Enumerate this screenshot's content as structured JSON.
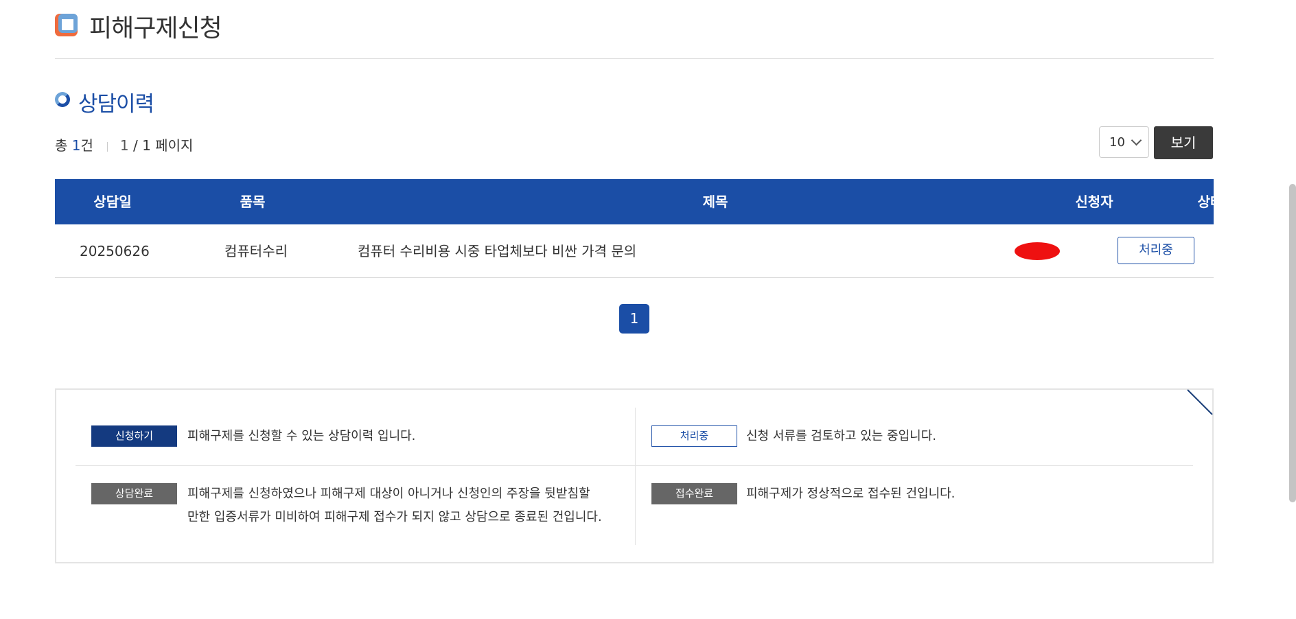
{
  "page": {
    "title": "피해구제신청"
  },
  "section": {
    "title": "상담이력"
  },
  "summary": {
    "total_prefix": "총 ",
    "total_count": "1",
    "total_suffix": "건",
    "current_page": "1",
    "page_rest": " / 1 페이지"
  },
  "controls": {
    "page_size_value": "10",
    "view_button_label": "보기"
  },
  "table": {
    "columns": [
      "상담일",
      "품목",
      "제목",
      "신청자",
      "상태"
    ],
    "rows": [
      {
        "date": "20250626",
        "item": "컴퓨터수리",
        "title": "컴퓨터 수리비용 시중 타업체보다 비싼 가격 문의",
        "applicant": "",
        "status": "처리중"
      }
    ]
  },
  "pagination": {
    "pages": [
      "1"
    ],
    "active": "1"
  },
  "legend": {
    "items": [
      {
        "tag": "신청하기",
        "text": "피해구제를 신청할 수 있는 상담이력 입니다."
      },
      {
        "tag": "처리중",
        "text": "신청 서류를 검토하고 있는 중입니다."
      },
      {
        "tag": "상담완료",
        "text_line1": "피해구제를 신청하였으나 피해구제 대상이 아니거나 신청인의 주장을 뒷받침할",
        "text_line2": "만한 입증서류가 미비하여 피해구제 접수가 되지 않고 상담으로 종료된 건입니다."
      },
      {
        "tag": "접수완료",
        "text": "피해구제가 정상적으로 접수된 건입니다."
      }
    ]
  },
  "colors": {
    "brand_blue": "#1b4ea6",
    "title_orange": "#ef6b3d",
    "tag_navy": "#143a80",
    "tag_gray": "#666666",
    "redaction_red": "#ee1111"
  }
}
